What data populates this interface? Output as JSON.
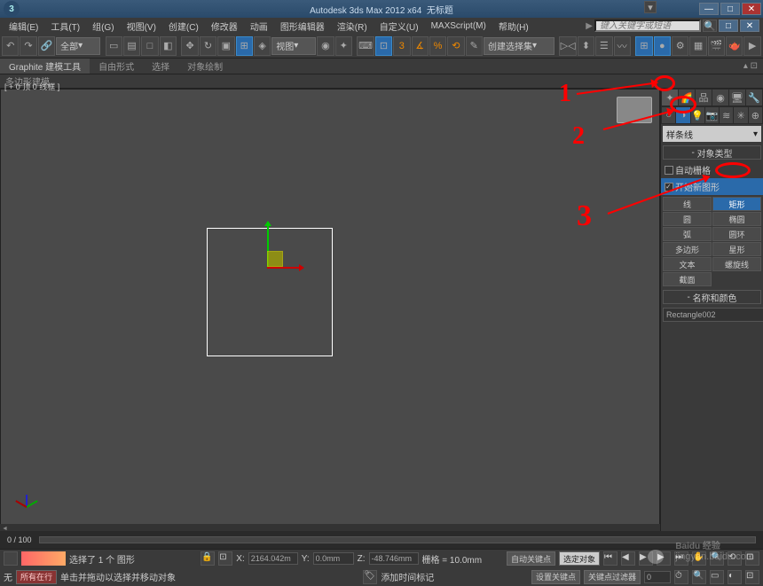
{
  "title": {
    "app": "Autodesk 3ds Max 2012 x64",
    "doc": "无标题"
  },
  "win": {
    "min": "—",
    "max": "□",
    "close": "✕"
  },
  "menu": {
    "edit": "编辑(E)",
    "tools": "工具(T)",
    "group": "组(G)",
    "views": "视图(V)",
    "create": "创建(C)",
    "modifiers": "修改器",
    "animation": "动画",
    "graph": "图形编辑器",
    "rendering": "渲染(R)",
    "customize": "自定义(U)",
    "maxscript": "MAXScript(M)",
    "help": "帮助(H)",
    "search_ph": "键入关键字或短语"
  },
  "tb": {
    "all": "全部",
    "view": "视图",
    "createsel": "创建选择集"
  },
  "ribbon": {
    "graphite": "Graphite 建模工具",
    "freeform": "自由形式",
    "selection": "选择",
    "objpaint": "对象绘制",
    "polymodel": "多边形建模"
  },
  "vp": {
    "label": "[ + 0 顶 0 线框 ]"
  },
  "panel": {
    "dropdown": "样条线",
    "rollout_objtype": "对象类型",
    "autogrid": "自动栅格",
    "startshape": "开始新图形",
    "btns": {
      "line": "线",
      "rectangle": "矩形",
      "circle": "圆",
      "ellipse": "椭圆",
      "arc": "弧",
      "donut": "圆环",
      "ngon": "多边形",
      "star": "星形",
      "text": "文本",
      "helix": "螺旋线",
      "section": "截面"
    },
    "rollout_name": "名称和颜色",
    "objname": "Rectangle002"
  },
  "timeline": {
    "pos": "0 / 100"
  },
  "status": {
    "sel": "选择了 1 个 图形",
    "hint": "单击并拖动以选择并移动对象",
    "x": "2164.042m",
    "y": "0.0mm",
    "z": "-48.746mm",
    "grid": "栅格 = 10.0mm",
    "autokey": "自动关键点",
    "setkey": "设置关键点",
    "selonly": "选定对象",
    "keyfilter": "关键点过滤器",
    "addmarker": "添加时间标记",
    "none": "无",
    "all": "所有在行"
  },
  "annotations": {
    "n1": "1",
    "n2": "2",
    "n3": "3"
  },
  "watermark": {
    "brand": "Baidu 经验",
    "url": "jingyan.baidu.com"
  }
}
